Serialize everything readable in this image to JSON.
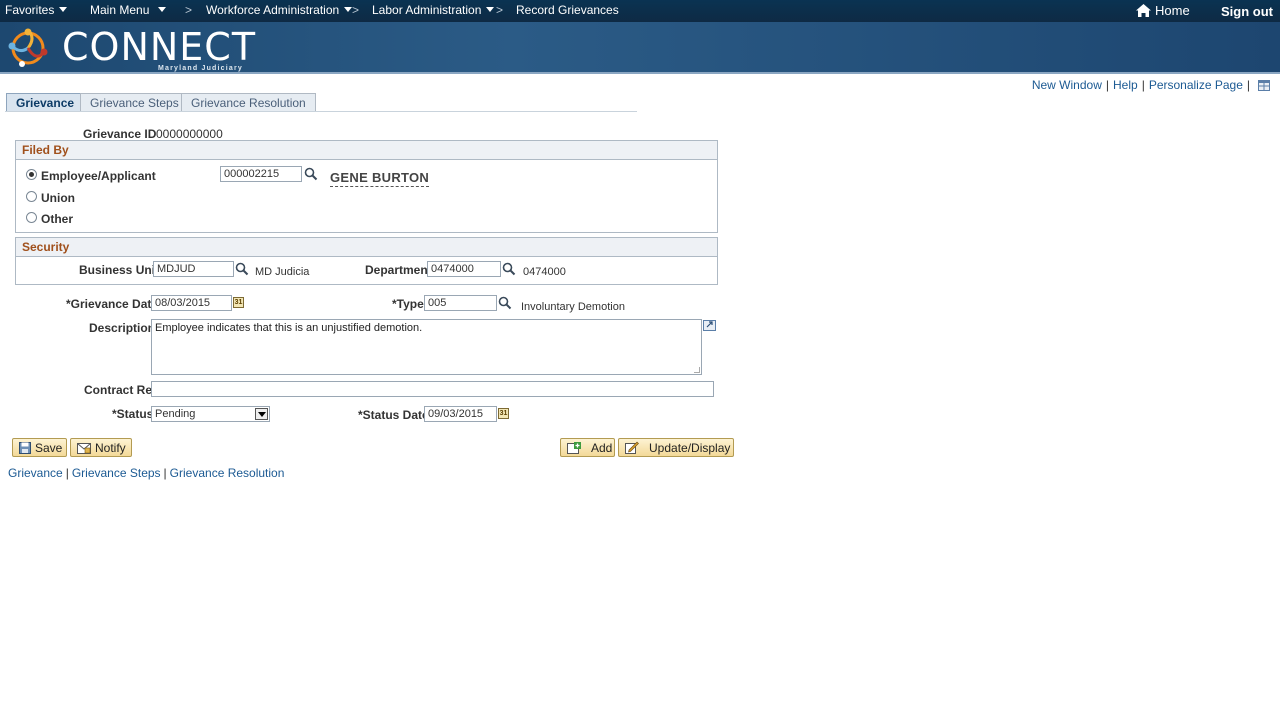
{
  "topnav": {
    "favorites": "Favorites",
    "main_menu": "Main Menu",
    "crumb1": "Workforce Administration",
    "crumb2": "Labor Administration",
    "crumb3": "Record Grievances",
    "separator": ">",
    "home": "Home",
    "signout": "Sign out"
  },
  "banner": {
    "logo_text": "CONNECT",
    "logo_sub": "Maryland Judiciary"
  },
  "pagelinks": {
    "new_window": "New Window",
    "help": "Help",
    "personalize": "Personalize Page",
    "bar": "|"
  },
  "tabs": [
    {
      "label": "Grievance",
      "active": true
    },
    {
      "label": "Grievance Steps",
      "active": false
    },
    {
      "label": "Grievance Resolution",
      "active": false
    }
  ],
  "form": {
    "grievance_id_label": "Grievance ID",
    "grievance_id_value": "0000000000",
    "filed_by": {
      "title": "Filed By",
      "employee_label": "Employee/Applicant",
      "union_label": "Union",
      "other_label": "Other",
      "selected": "Employee/Applicant",
      "employee_id": "000002215",
      "employee_name": "GENE BURTON"
    },
    "security": {
      "title": "Security",
      "business_unit_label": "Business Unit",
      "business_unit_value": "MDJUD",
      "business_unit_desc": "MD Judicia",
      "department_label": "Department",
      "department_value": "0474000",
      "department_desc": "0474000"
    },
    "grievance_date_label": "*Grievance Date",
    "grievance_date_value": "08/03/2015",
    "type_label": "*Type",
    "type_value": "005",
    "type_desc": "Involuntary Demotion",
    "description_label": "Description",
    "description_value": "Employee indicates that this is an unjustified demotion.",
    "contract_ref_label": "Contract Ref",
    "contract_ref_value": "",
    "status_label": "*Status",
    "status_value": "Pending",
    "status_date_label": "*Status Date",
    "status_date_value": "09/03/2015",
    "calendar_glyph": "31"
  },
  "buttons": {
    "save": "Save",
    "notify": "Notify",
    "add": "Add",
    "update_display": "Update/Display"
  },
  "bottom_links": {
    "grievance": "Grievance",
    "steps": "Grievance Steps",
    "resolution": "Grievance Resolution",
    "bar": "|"
  },
  "colors": {
    "nav_bg": "#0e2a44",
    "banner_bg": "#2b5b86",
    "group_header_text": "#a0501c",
    "link": "#1c5a93",
    "button_bg": "#f3d998"
  }
}
